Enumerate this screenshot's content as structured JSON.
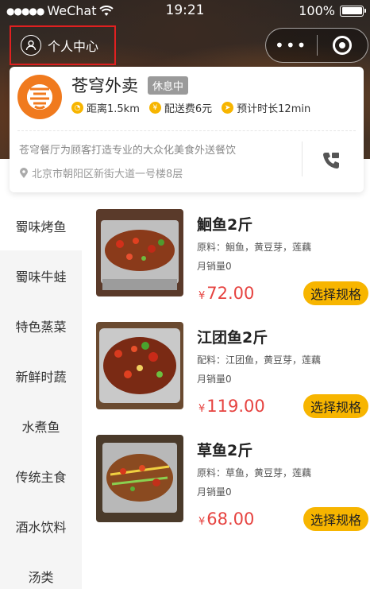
{
  "status_bar": {
    "carrier": "WeChat",
    "time": "19:21",
    "battery": "100%"
  },
  "nav": {
    "profile_label": "个人中心",
    "capsule_more": "•••"
  },
  "shop": {
    "name": "苍穹外卖",
    "status": "休息中",
    "distance": "距离1.5km",
    "delivery_fee": "配送费6元",
    "eta": "预计时长12min",
    "description": "苍穹餐厅为顾客打造专业的大众化美食外送餐饮",
    "address": "北京市朝阳区新街大道一号楼8层"
  },
  "categories": [
    {
      "label": "蜀味烤鱼",
      "active": true
    },
    {
      "label": "蜀味牛蛙",
      "active": false
    },
    {
      "label": "特色蒸菜",
      "active": false
    },
    {
      "label": "新鲜时蔬",
      "active": false
    },
    {
      "label": "水煮鱼",
      "active": false
    },
    {
      "label": "传统主食",
      "active": false
    },
    {
      "label": "酒水饮料",
      "active": false
    },
    {
      "label": "汤类",
      "active": false
    }
  ],
  "products": [
    {
      "name": "鮰鱼2斤",
      "desc": "原料：鮰鱼，黄豆芽，莲藕",
      "sales": "月销量0",
      "currency": "¥",
      "price": "72.00",
      "spec_label": "选择规格"
    },
    {
      "name": "江团鱼2斤",
      "desc": "配料：江团鱼，黄豆芽，莲藕",
      "sales": "月销量0",
      "currency": "¥",
      "price": "119.00",
      "spec_label": "选择规格"
    },
    {
      "name": "草鱼2斤",
      "desc": "原料：草鱼，黄豆芽，莲藕",
      "sales": "月销量0",
      "currency": "¥",
      "price": "68.00",
      "spec_label": "选择规格"
    }
  ],
  "colors": {
    "accent": "#f7b500",
    "price": "#e64340",
    "highlight_border": "#e02020"
  }
}
